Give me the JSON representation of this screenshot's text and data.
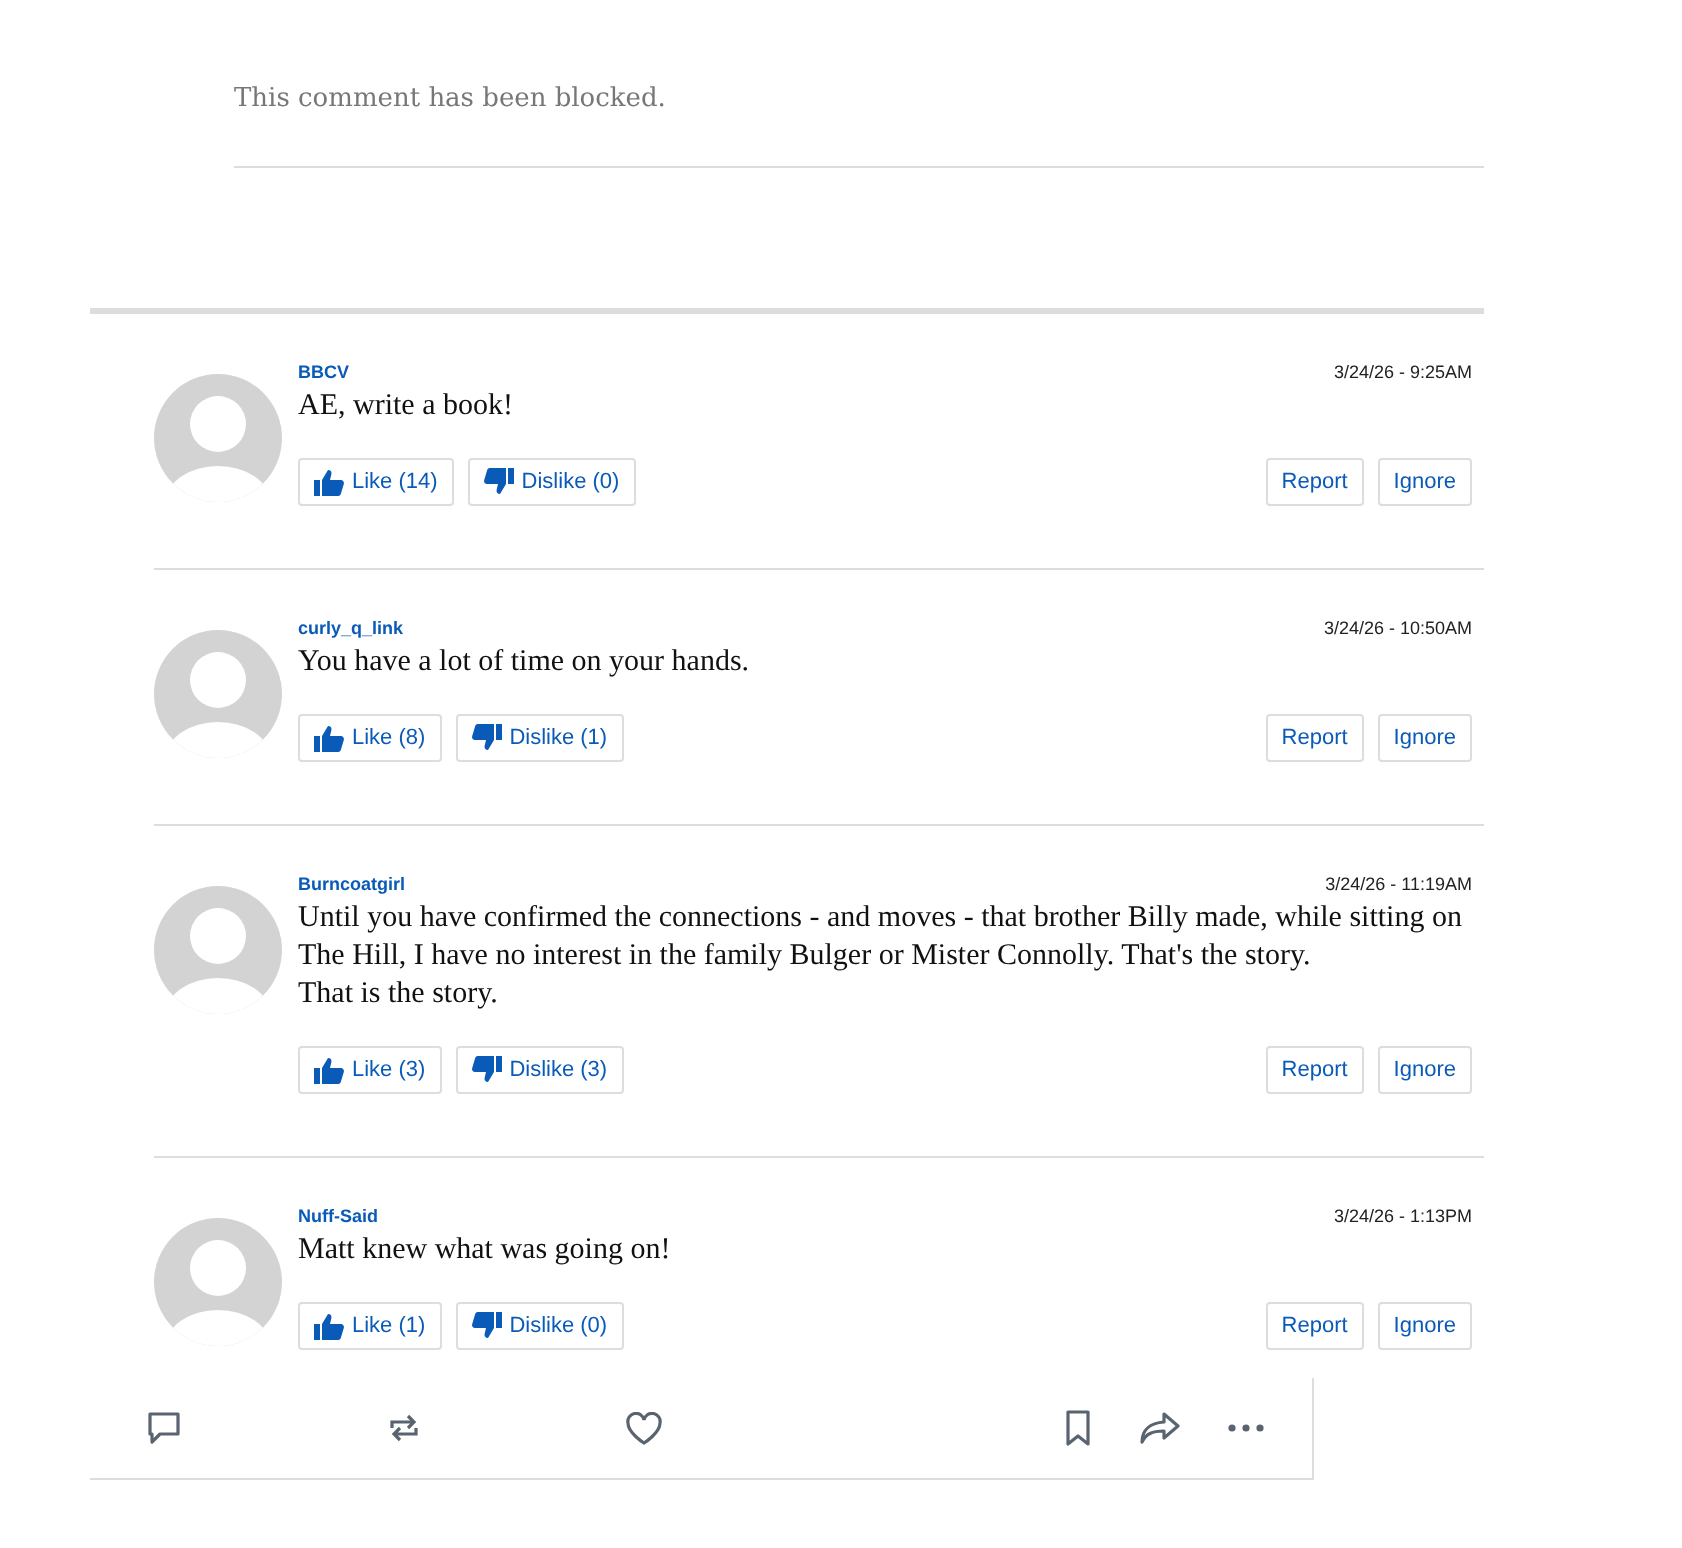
{
  "blocked_notice": "This comment has been blocked.",
  "comments": [
    {
      "author": "BBCV",
      "time": "3/24/26 - 9:25AM",
      "text": "AE, write a book!",
      "like": "Like (14)",
      "dislike": "Dislike (0)",
      "report": "Report",
      "ignore": "Ignore"
    },
    {
      "author": "curly_q_link",
      "time": "3/24/26 - 10:50AM",
      "text": "You have a lot of time on your hands.",
      "like": "Like (8)",
      "dislike": "Dislike (1)",
      "report": "Report",
      "ignore": "Ignore"
    },
    {
      "author": "Burncoatgirl",
      "time": "3/24/26 - 11:19AM",
      "text": "Until you have confirmed the connections - and moves - that brother Billy made, while sitting on The Hill, I have no interest in the family Bulger or Mister Connolly. That's the story.\nThat is the story.",
      "like": "Like (3)",
      "dislike": "Dislike (3)",
      "report": "Report",
      "ignore": "Ignore"
    },
    {
      "author": "Nuff-Said",
      "time": "3/24/26 - 1:13PM",
      "text": "Matt knew what was going on!",
      "like": "Like (1)",
      "dislike": "Dislike (0)",
      "report": "Report",
      "ignore": "Ignore"
    }
  ],
  "action_bar": {
    "icons": [
      {
        "kind": "comment"
      },
      {
        "kind": "repost"
      },
      {
        "kind": "like"
      },
      {
        "kind": "bookmark"
      },
      {
        "kind": "share"
      },
      {
        "kind": "more"
      }
    ]
  }
}
